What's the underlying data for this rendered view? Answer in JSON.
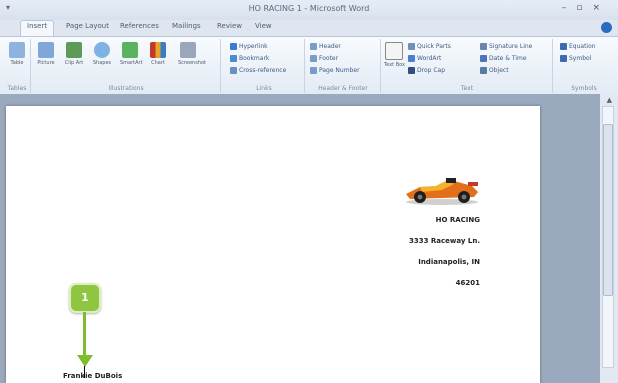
{
  "window": {
    "title": "HO RACING 1 - Microsoft Word"
  },
  "tabs": [
    "Insert",
    "Page Layout",
    "References",
    "Mailings",
    "Review",
    "View"
  ],
  "ribbon": {
    "groups": [
      {
        "label": "Tables",
        "items": [
          {
            "label": "Table",
            "icon": "table-icon"
          }
        ]
      },
      {
        "label": "Illustrations",
        "items": [
          {
            "label": "Picture",
            "icon": "picture-icon"
          },
          {
            "label": "Clip Art",
            "icon": "clip-art-icon"
          },
          {
            "label": "Shapes",
            "icon": "shapes-icon"
          },
          {
            "label": "SmartArt",
            "icon": "smartart-icon"
          },
          {
            "label": "Chart",
            "icon": "chart-icon"
          },
          {
            "label": "Screenshot",
            "icon": "screenshot-icon"
          }
        ]
      },
      {
        "label": "Links",
        "items": [
          {
            "label": "Hyperlink"
          },
          {
            "label": "Bookmark"
          },
          {
            "label": "Cross-reference"
          }
        ]
      },
      {
        "label": "Header & Footer",
        "items": [
          {
            "label": "Header"
          },
          {
            "label": "Footer"
          },
          {
            "label": "Page Number"
          }
        ]
      },
      {
        "label": "Text",
        "items": [
          {
            "label": "Text Box"
          },
          {
            "label": "Quick Parts"
          },
          {
            "label": "WordArt"
          },
          {
            "label": "Drop Cap"
          },
          {
            "label": "Signature Line"
          },
          {
            "label": "Date & Time"
          },
          {
            "label": "Object"
          }
        ]
      },
      {
        "label": "Symbols",
        "items": [
          {
            "label": "Equation"
          },
          {
            "label": "Symbol"
          }
        ]
      }
    ]
  },
  "document": {
    "address": [
      "HO RACING",
      "3333 Raceway Ln.",
      "Indianapolis, IN",
      "46201"
    ],
    "greeting": "Frankie DuBois"
  },
  "callout": {
    "number": "1"
  },
  "colors": {
    "accent": "#8fc63f"
  }
}
